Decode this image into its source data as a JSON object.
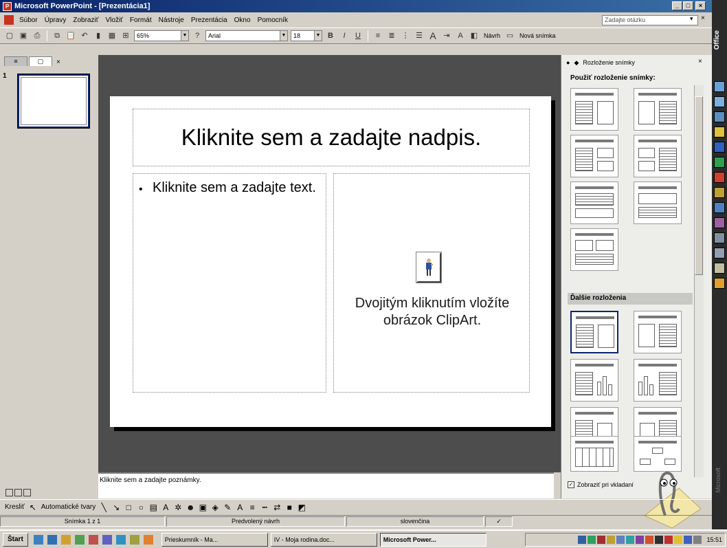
{
  "window": {
    "title": "Microsoft PowerPoint - [Prezentácia1]"
  },
  "menu": {
    "items": [
      "Súbor",
      "Úpravy",
      "Zobraziť",
      "Vložiť",
      "Formát",
      "Nástroje",
      "Prezentácia",
      "Okno",
      "Pomocník"
    ],
    "help_placeholder": "Zadajte otázku"
  },
  "toolbar": {
    "zoom": "65%",
    "font": "Arial",
    "font_size": "18",
    "bold": "B",
    "italic": "I",
    "underline": "U",
    "design_label": "Návrh",
    "new_slide_label": "Nová snímka"
  },
  "outline": {
    "slide_number": "1"
  },
  "slide": {
    "title_placeholder": "Kliknite sem a zadajte nadpis.",
    "text_placeholder": "Kliknite sem a zadajte text.",
    "bullet": "•",
    "clipart_placeholder": "Dvojitým kliknutím vložíte obrázok ClipArt."
  },
  "notes": {
    "placeholder": "Kliknite sem a zadajte poznámky."
  },
  "taskpane": {
    "header": "Rozloženie snímky",
    "apply_title": "Použiť rozloženie snímky:",
    "more_layouts": "Ďalšie rozloženia",
    "show_on_insert": "Zobraziť pri vkladaní",
    "show_on_insert_checked": true
  },
  "drawbar": {
    "draw_label": "Kresliť",
    "autoshapes_label": "Automatické tvary"
  },
  "status": {
    "slide_info": "Snímka 1 z 1",
    "design": "Predvolený návrh",
    "language": "slovenčina"
  },
  "taskbar": {
    "start_label": "Štart",
    "tasks": [
      "Prieskumník - Ma...",
      "IV - Moja rodina.doc...",
      "Microsoft Power..."
    ],
    "active_task_index": 2,
    "clock": "15:51"
  },
  "officebar": {
    "label": "Office",
    "brand": "Microsoft"
  },
  "colors": {
    "titlebar": "#0a246a",
    "edit_background": "#4d4d4d",
    "slide": "#ffffff",
    "chrome": "#d4d0c8"
  }
}
